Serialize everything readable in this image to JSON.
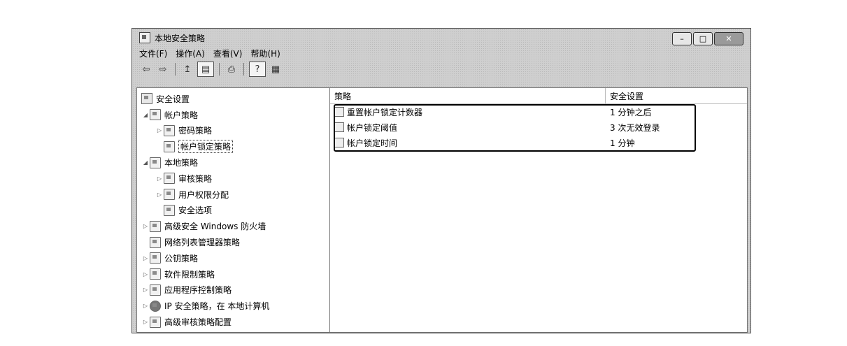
{
  "window": {
    "title": "本地安全策略",
    "buttons": {
      "minimize": "–",
      "maximize": "□",
      "close": "✕"
    }
  },
  "menu": [
    "文件(F)",
    "操作(A)",
    "查看(V)",
    "帮助(H)"
  ],
  "toolbar": {
    "back": "⇦",
    "forward": "⇨",
    "up": "↥",
    "show_tree": "▤",
    "export": "⎙",
    "help": "?",
    "properties": "▦"
  },
  "tree": [
    {
      "label": "安全设置",
      "caret": "",
      "icon": "root-icon"
    },
    {
      "label": "帐户策略",
      "caret": "◢",
      "icon": "folder-icon"
    },
    {
      "label": "密码策略",
      "caret": "▷",
      "icon": "folder-icon"
    },
    {
      "label": "帐户锁定策略",
      "caret": "",
      "icon": "folder-icon",
      "selected": true
    },
    {
      "label": "本地策略",
      "caret": "◢",
      "icon": "folder-icon"
    },
    {
      "label": "审核策略",
      "caret": "▷",
      "icon": "folder-icon"
    },
    {
      "label": "用户权限分配",
      "caret": "▷",
      "icon": "folder-icon"
    },
    {
      "label": "安全选项",
      "caret": "",
      "icon": "folder-icon"
    },
    {
      "label": "高级安全 Windows 防火墙",
      "caret": "▷",
      "icon": "folder-icon"
    },
    {
      "label": "网络列表管理器策略",
      "caret": "",
      "icon": "folder-icon"
    },
    {
      "label": "公钥策略",
      "caret": "▷",
      "icon": "folder-icon"
    },
    {
      "label": "软件限制策略",
      "caret": "▷",
      "icon": "folder-icon"
    },
    {
      "label": "应用程序控制策略",
      "caret": "▷",
      "icon": "folder-icon"
    },
    {
      "label": "IP 安全策略，在 本地计算机",
      "caret": "▷",
      "icon": "globe-icon"
    },
    {
      "label": "高级审核策略配置",
      "caret": "▷",
      "icon": "folder-icon"
    }
  ],
  "list": {
    "columns": {
      "policy": "策略",
      "setting": "安全设置"
    },
    "rows": [
      {
        "policy": "重置帐户锁定计数器",
        "setting": "1 分钟之后"
      },
      {
        "policy": "帐户锁定阈值",
        "setting": "3 次无效登录"
      },
      {
        "policy": "帐户锁定时间",
        "setting": "1 分钟"
      }
    ]
  }
}
